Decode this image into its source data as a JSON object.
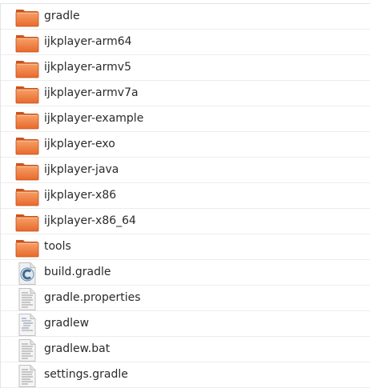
{
  "file_list": {
    "items": [
      {
        "name": "gradle",
        "type": "folder",
        "icon": "folder-icon"
      },
      {
        "name": "ijkplayer-arm64",
        "type": "folder",
        "icon": "folder-icon"
      },
      {
        "name": "ijkplayer-armv5",
        "type": "folder",
        "icon": "folder-icon"
      },
      {
        "name": "ijkplayer-armv7a",
        "type": "folder",
        "icon": "folder-icon"
      },
      {
        "name": "ijkplayer-example",
        "type": "folder",
        "icon": "folder-icon"
      },
      {
        "name": "ijkplayer-exo",
        "type": "folder",
        "icon": "folder-icon"
      },
      {
        "name": "ijkplayer-java",
        "type": "folder",
        "icon": "folder-icon"
      },
      {
        "name": "ijkplayer-x86",
        "type": "folder",
        "icon": "folder-icon"
      },
      {
        "name": "ijkplayer-x86_64",
        "type": "folder",
        "icon": "folder-icon"
      },
      {
        "name": "tools",
        "type": "folder",
        "icon": "folder-icon"
      },
      {
        "name": "build.gradle",
        "type": "source",
        "icon": "groovy-file-icon"
      },
      {
        "name": "gradle.properties",
        "type": "text",
        "icon": "text-file-icon"
      },
      {
        "name": "gradlew",
        "type": "script",
        "icon": "script-file-icon"
      },
      {
        "name": "gradlew.bat",
        "type": "text",
        "icon": "text-file-icon"
      },
      {
        "name": "settings.gradle",
        "type": "text",
        "icon": "text-file-icon"
      }
    ]
  },
  "colors": {
    "folder_orange": "#e8692b",
    "folder_light": "#f7a26a",
    "file_grey": "#bfbfbf"
  }
}
